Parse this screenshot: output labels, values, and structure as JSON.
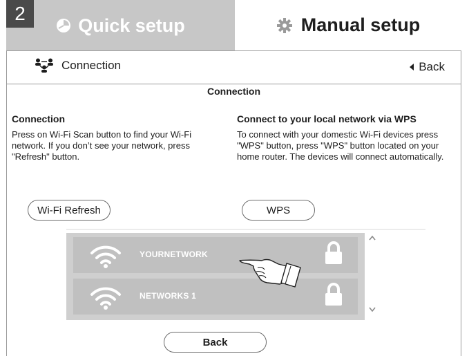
{
  "step_badge": "2",
  "tabs": {
    "quick": "Quick setup",
    "manual": "Manual setup"
  },
  "header": {
    "breadcrumb": "Connection",
    "back": "Back"
  },
  "section_title": "Connection",
  "left": {
    "title": "Connection",
    "body": "Press on Wi-Fi Scan button to find your Wi-Fi network. If you don’t see your network, press \"Refresh\" button.",
    "button": "Wi-Fi Refresh"
  },
  "right": {
    "title": "Connect to your local network via WPS",
    "body": "To connect with your domestic Wi-Fi devices press \"WPS\" button, press \"WPS\" button located on your home router. The devices will connect automatically.",
    "button": "WPS"
  },
  "networks": [
    {
      "name": "YOURNETWORK",
      "icon": "wifi-icon",
      "locked": true
    },
    {
      "name": "NETWORKS 1",
      "icon": "wifi-icon",
      "locked": true
    }
  ],
  "footer": {
    "back": "Back"
  },
  "colors": {
    "tab_inactive_bg": "#c7c7c7",
    "list_bg": "#cfcfcf",
    "row_bg": "#c0c0c0",
    "badge_bg": "#4a4a4a"
  }
}
